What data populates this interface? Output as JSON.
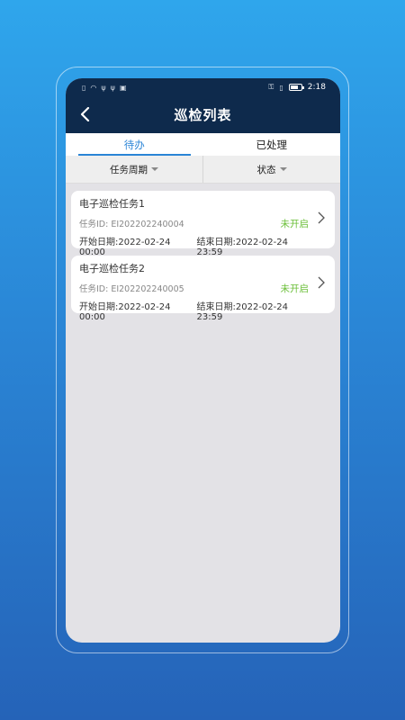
{
  "status_bar": {
    "time": "2:18",
    "left_icons": [
      "sim-icon",
      "wifi-icon",
      "usb-icon",
      "usb-icon",
      "sim-card-icon"
    ],
    "right_icons": [
      "key-icon",
      "vibrate-icon",
      "battery-icon"
    ]
  },
  "header": {
    "title": "巡检列表",
    "back_icon": "chevron-left-icon"
  },
  "tabs": [
    {
      "label": "待办",
      "active": true
    },
    {
      "label": "已处理",
      "active": false
    }
  ],
  "filters": [
    {
      "label": "任务周期"
    },
    {
      "label": "状态"
    }
  ],
  "tasks": [
    {
      "name": "电子巡检任务1",
      "id_text": "任务ID: EI202202240004",
      "status": "未开启",
      "start": "开始日期:2022-02-24 00:00",
      "end": "结束日期:2022-02-24 23:59"
    },
    {
      "name": "电子巡检任务2",
      "id_text": "任务ID: EI202202240005",
      "status": "未开启",
      "start": "开始日期:2022-02-24 00:00",
      "end": "结束日期:2022-02-24 23:59"
    }
  ],
  "colors": {
    "header_bg": "#0e2a4c",
    "accent": "#2a84d6",
    "status_green": "#6cbf3a"
  }
}
